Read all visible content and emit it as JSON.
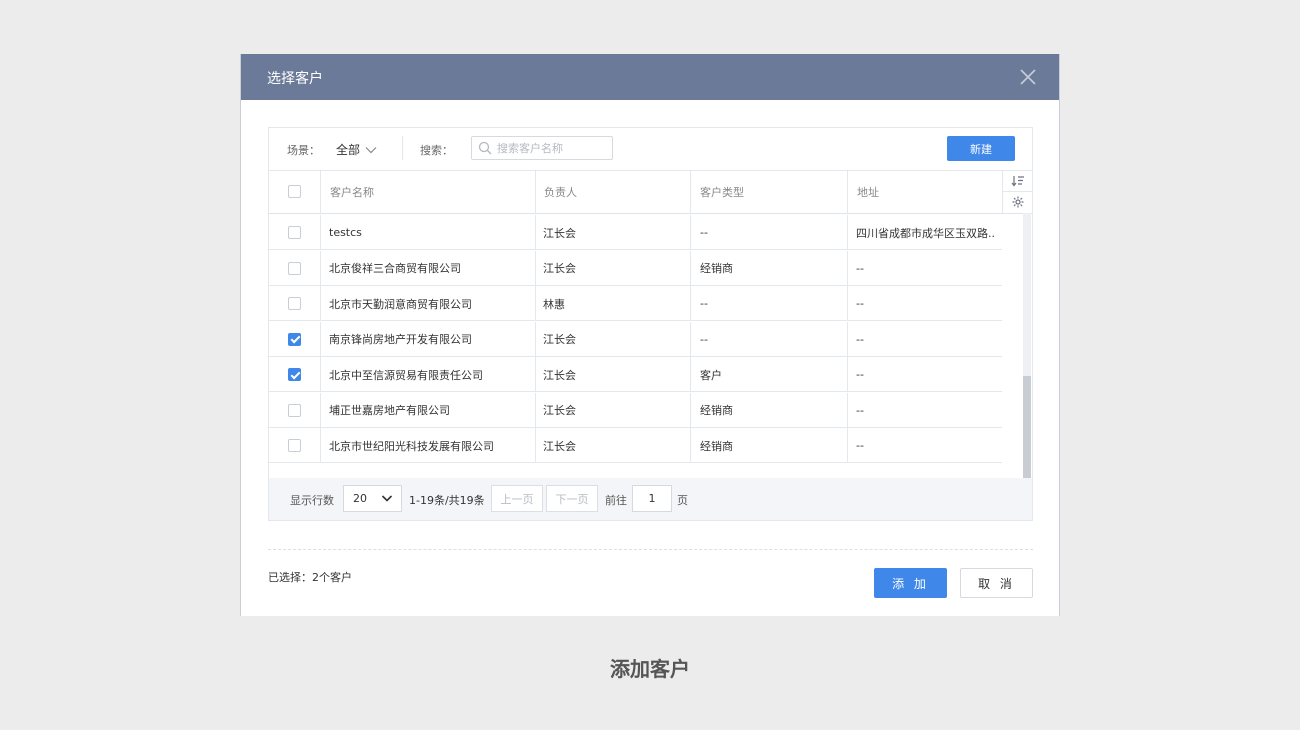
{
  "dialog": {
    "title": "选择客户",
    "close_icon": "close-icon"
  },
  "toolbar": {
    "scene_label": "场景：",
    "scene_value": "全部",
    "search_label": "搜索：",
    "search_placeholder": "搜索客户名称",
    "search_value": "",
    "new_button": "新建"
  },
  "table": {
    "columns": [
      "客户名称",
      "负责人",
      "客户类型",
      "地址"
    ],
    "rows": [
      {
        "name": "testcs",
        "owner": "江长会",
        "type": "--",
        "address": "四川省成都市成华区玉双路...",
        "checked": false
      },
      {
        "name": "北京俊祥三合商贸有限公司",
        "owner": "江长会",
        "type": "经销商",
        "address": "--",
        "checked": false
      },
      {
        "name": "北京市天勤润意商贸有限公司",
        "owner": "林惠",
        "type": "--",
        "address": "--",
        "checked": false
      },
      {
        "name": "南京锋尚房地产开发有限公司",
        "owner": "江长会",
        "type": "--",
        "address": "--",
        "checked": true
      },
      {
        "name": "北京中至信源贸易有限责任公司",
        "owner": "江长会",
        "type": "客户",
        "address": "--",
        "checked": true
      },
      {
        "name": "埔正世嘉房地产有限公司",
        "owner": "江长会",
        "type": "经销商",
        "address": "--",
        "checked": false
      },
      {
        "name": "北京市世纪阳光科技发展有限公司",
        "owner": "江长会",
        "type": "经销商",
        "address": "--",
        "checked": false
      }
    ]
  },
  "pagination": {
    "rows_label": "显示行数",
    "page_size": "20",
    "range_text": "1-19条/共19条",
    "prev": "上一页",
    "next": "下一页",
    "goto_label": "前往",
    "page_value": "1",
    "page_suffix": "页"
  },
  "footer": {
    "selected_text": "已选择：2个客户",
    "add_button": "添 加",
    "cancel_button": "取 消"
  },
  "caption": "添加客户",
  "colors": {
    "header_bg": "#6b7a99",
    "primary": "#3f87e8",
    "page_bg": "#ececec"
  }
}
